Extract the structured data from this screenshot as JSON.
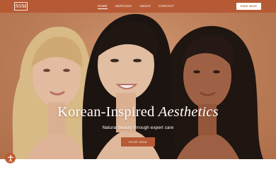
{
  "header": {
    "logo_text": "NSM",
    "nav": [
      {
        "label": "HOME",
        "active": true
      },
      {
        "label": "SERVICES",
        "active": false
      },
      {
        "label": "ABOUT",
        "active": false
      },
      {
        "label": "CONTACT",
        "active": false
      }
    ],
    "signin_label": "SIGN IN/UP"
  },
  "hero": {
    "headline_main": "Korean-Inspired ",
    "headline_italic": "Aesthetics",
    "subheadline": "Natural beauty through expert care",
    "cta_label": "BOOK NOW"
  },
  "accessibility": {
    "icon": "accessibility-icon"
  },
  "colors": {
    "brand": "#b65a35",
    "background": "#c98a62"
  }
}
